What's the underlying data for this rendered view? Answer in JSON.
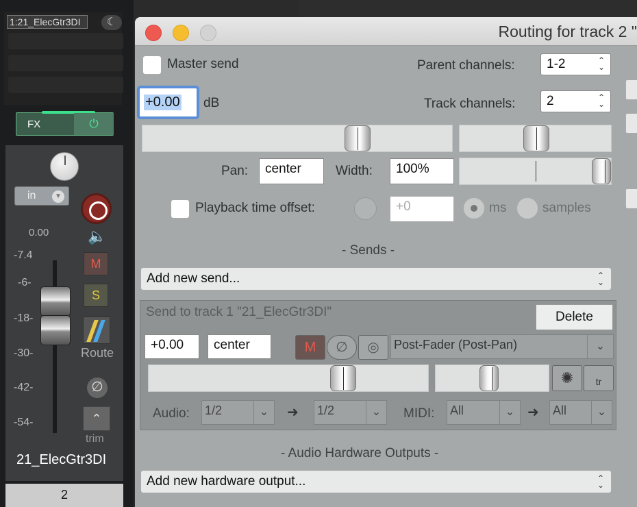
{
  "mixer": {
    "track_name_box": "1:21_ElecGtr3DI",
    "fx_label": "FX",
    "input_label": "in",
    "volume_readout": "0.00",
    "db_scale": [
      "-7.4",
      "-6-",
      "-18-",
      "-30-",
      "-42-",
      "-54-"
    ],
    "mute_label": "M",
    "solo_label": "S",
    "route_label": "Route",
    "trim_label": "trim",
    "track_name": "21_ElecGtr3DI",
    "track_number": "2"
  },
  "dialog": {
    "title": "Routing for track 2 \"",
    "master_send_label": "Master send",
    "parent_channels_label": "Parent channels:",
    "parent_channels_value": "1-2",
    "volume_value": "+0.00",
    "db_label": "dB",
    "track_channels_label": "Track channels:",
    "track_channels_value": "2",
    "pan_label": "Pan:",
    "pan_value": "center",
    "width_label": "Width:",
    "width_value": "100%",
    "playback_offset_label": "Playback time offset:",
    "playback_offset_value": "+0",
    "ms_label": "ms",
    "samples_label": "samples",
    "sends_header": "-  Sends  -",
    "add_send_label": "Add new send...",
    "send": {
      "title": "Send to track 1 \"21_ElecGtr3DI\"",
      "delete_label": "Delete",
      "volume_value": "+0.00",
      "pan_value": "center",
      "mute_label": "M",
      "mode_value": "Post-Fader (Post-Pan)",
      "audio_label": "Audio:",
      "audio_src": "1/2",
      "audio_dst": "1/2",
      "midi_label": "MIDI:",
      "midi_src": "All",
      "midi_dst": "All",
      "arrow": "➜",
      "tr_label": "tr"
    },
    "hw_header": "-  Audio Hardware Outputs  -",
    "add_hw_label": "Add new hardware output..."
  },
  "colors": {
    "close": "#ee5a52",
    "minimize": "#f6bd2f",
    "zoom": "#c8c8c8",
    "accent_focus": "#5a8fd8",
    "record": "#8a2a24"
  }
}
